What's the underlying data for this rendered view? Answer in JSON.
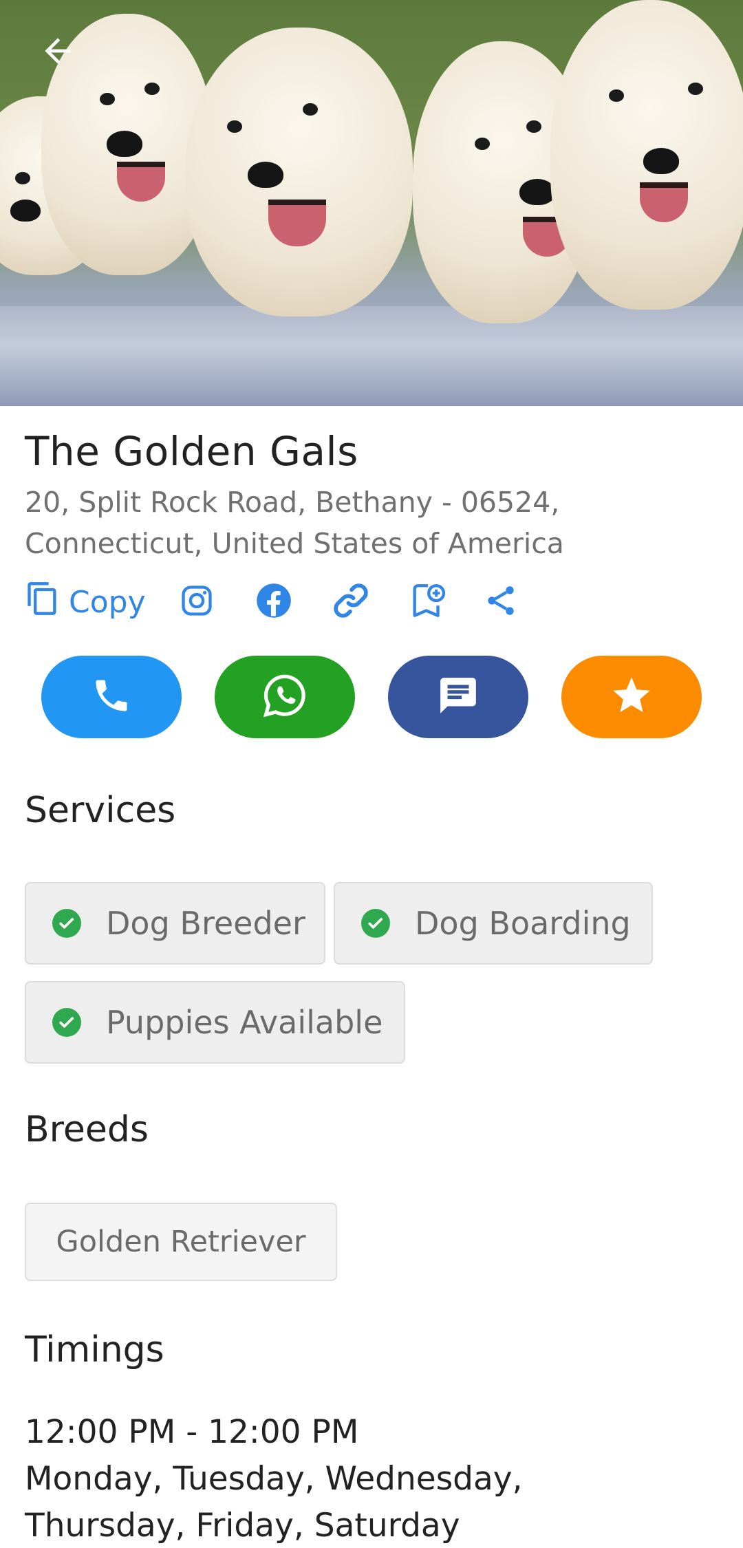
{
  "header": {
    "back_icon": "arrow-left-icon",
    "photo_description_icon": "hero-photo"
  },
  "business": {
    "name": "The Golden Gals",
    "address_line1": "20, Split Rock Road, Bethany - 06524,",
    "address_line2": "Connecticut, United States of America"
  },
  "actions": {
    "copy_label": "Copy",
    "icons": [
      "copy-icon",
      "instagram-icon",
      "facebook-icon",
      "link-icon",
      "bookmark-add-icon",
      "share-icon"
    ],
    "accent_color": "#2f86e6"
  },
  "contact_buttons": [
    {
      "icon": "phone-icon",
      "color": "#2196f3"
    },
    {
      "icon": "whatsapp-icon",
      "color": "#22a122"
    },
    {
      "icon": "message-icon",
      "color": "#36559c"
    },
    {
      "icon": "star-icon",
      "color": "#fb8c00"
    }
  ],
  "services": {
    "title": "Services",
    "items": [
      "Dog Breeder",
      "Dog Boarding",
      "Puppies Available"
    ],
    "check_color": "#2fa84f"
  },
  "breeds": {
    "title": "Breeds",
    "items": [
      "Golden Retriever"
    ]
  },
  "timings": {
    "title": "Timings",
    "hours": "12:00 PM - 12:00 PM",
    "days_line1": "Monday, Tuesday, Wednesday,",
    "days_line2": "Thursday, Friday, Saturday"
  }
}
